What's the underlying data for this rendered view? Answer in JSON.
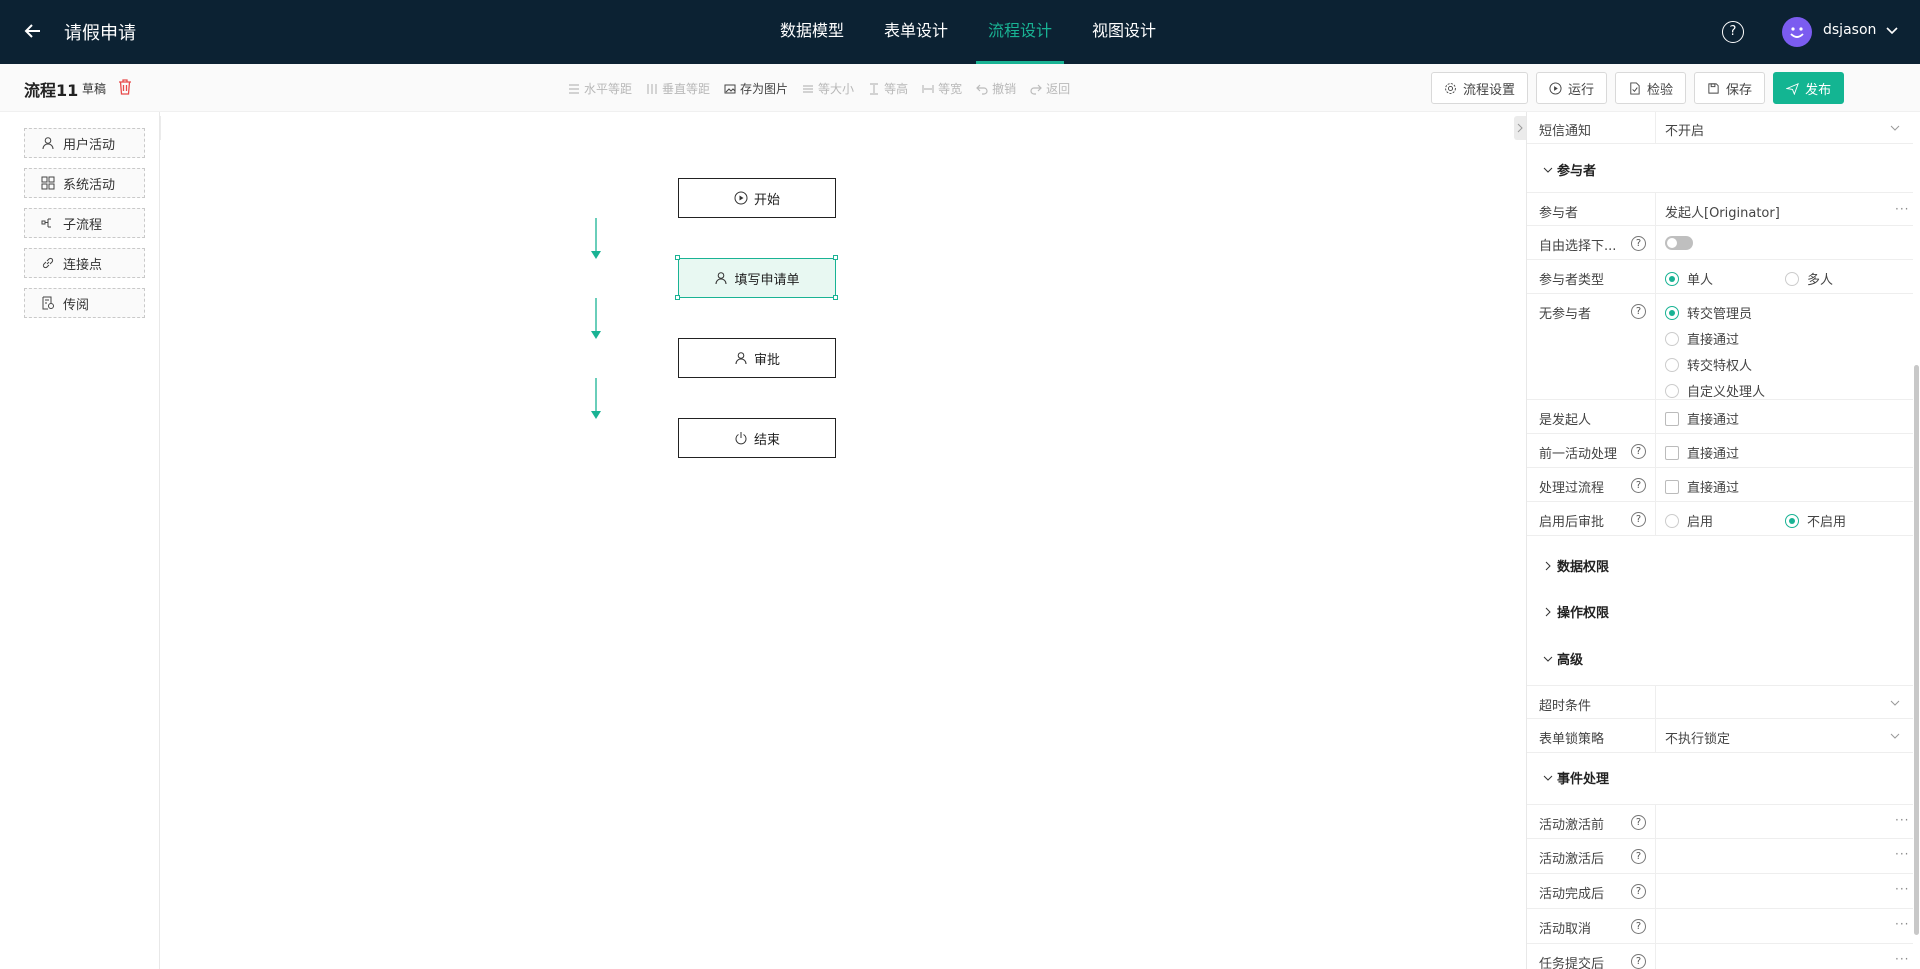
{
  "header": {
    "app_title": "请假申请",
    "tabs": [
      {
        "label": "数据模型",
        "active": false
      },
      {
        "label": "表单设计",
        "active": false
      },
      {
        "label": "流程设计",
        "active": true
      },
      {
        "label": "视图设计",
        "active": false
      }
    ],
    "help_symbol": "?",
    "username": "dsjason",
    "accent_color": "#19b394",
    "avatar_color": "#7b5cf0"
  },
  "toolbar": {
    "process_name": "流程11",
    "status": "草稿",
    "tools": [
      {
        "label": "水平等距",
        "enabled": false
      },
      {
        "label": "垂直等距",
        "enabled": false
      },
      {
        "label": "存为图片",
        "enabled": true
      },
      {
        "label": "等大小",
        "enabled": false
      },
      {
        "label": "等高",
        "enabled": false
      },
      {
        "label": "等宽",
        "enabled": false
      },
      {
        "label": "撤销",
        "enabled": false
      },
      {
        "label": "返回",
        "enabled": false
      }
    ],
    "buttons": {
      "settings": "流程设置",
      "run": "运行",
      "check": "检验",
      "save": "保存",
      "publish": "发布"
    }
  },
  "palette": {
    "items": [
      {
        "label": "用户活动",
        "icon": "user-icon"
      },
      {
        "label": "系统活动",
        "icon": "grid-icon"
      },
      {
        "label": "子流程",
        "icon": "subprocess-icon"
      },
      {
        "label": "连接点",
        "icon": "link-icon"
      },
      {
        "label": "传阅",
        "icon": "circulate-icon"
      }
    ]
  },
  "flow": {
    "nodes": [
      {
        "label": "开始",
        "icon": "play-icon"
      },
      {
        "label": "填写申请单",
        "icon": "user-icon",
        "selected": true
      },
      {
        "label": "审批",
        "icon": "user-icon"
      },
      {
        "label": "结束",
        "icon": "power-icon"
      }
    ]
  },
  "props": {
    "sms_label": "短信通知",
    "sms_value": "不开启",
    "participants_section": "参与者",
    "participant_label": "参与者",
    "participant_value": "发起人[Originator]",
    "free_select_label": "自由选择下...",
    "participant_type_label": "参与者类型",
    "participant_type_options": [
      "单人",
      "多人"
    ],
    "no_participant_label": "无参与者",
    "no_participant_options": [
      "转交管理员",
      "直接通过",
      "转交特权人",
      "自定义处理人"
    ],
    "is_initiator_label": "是发起人",
    "is_initiator_check": "直接通过",
    "prev_activity_label": "前一活动处理",
    "prev_activity_check": "直接通过",
    "processed_label": "处理过流程",
    "processed_check": "直接通过",
    "post_approve_label": "启用后审批",
    "post_approve_options": [
      "启用",
      "不启用"
    ],
    "data_perm_section": "数据权限",
    "op_perm_section": "操作权限",
    "advanced_section": "高级",
    "timeout_label": "超时条件",
    "timeout_value": "",
    "form_lock_label": "表单锁策略",
    "form_lock_value": "不执行锁定",
    "events_section": "事件处理",
    "events": [
      "活动激活前",
      "活动激活后",
      "活动完成后",
      "活动取消",
      "任务提交后"
    ],
    "dots": "···",
    "help_symbol": "?"
  }
}
